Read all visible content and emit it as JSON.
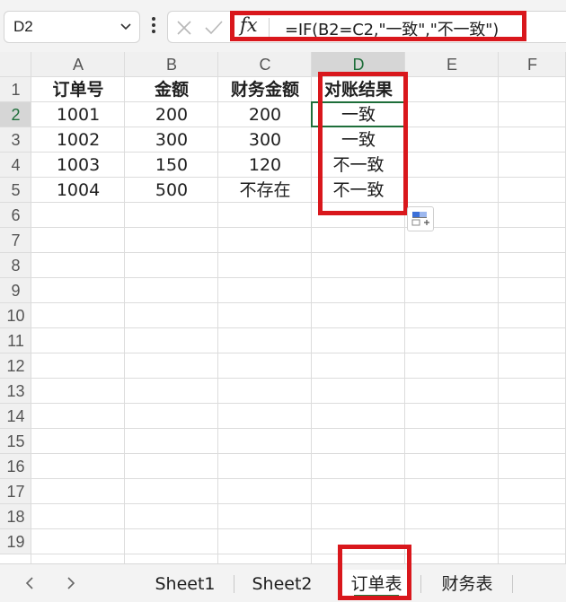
{
  "formula_bar": {
    "name_box": "D2",
    "fx_label": "fx",
    "formula": "=IF(B2=C2,\"一致\",\"不一致\")"
  },
  "columns": [
    "A",
    "B",
    "C",
    "D",
    "E",
    "F"
  ],
  "rows": [
    "1",
    "2",
    "3",
    "4",
    "5",
    "6",
    "7",
    "8",
    "9",
    "10",
    "11",
    "12",
    "13",
    "14",
    "15",
    "16",
    "17",
    "18",
    "19"
  ],
  "cells": {
    "A1": "订单号",
    "B1": "金额",
    "C1": "财务金额",
    "D1": "对账结果",
    "A2": "1001",
    "B2": "200",
    "C2": "200",
    "D2": "一致",
    "A3": "1002",
    "B3": "300",
    "C3": "300",
    "D3": "一致",
    "A4": "1003",
    "B4": "150",
    "C4": "120",
    "D4": "不一致",
    "A5": "1004",
    "B5": "500",
    "C5": "不存在",
    "D5": "不一致"
  },
  "selected_cell": "D2",
  "sheet_tabs": [
    "Sheet1",
    "Sheet2",
    "订单表",
    "财务表"
  ],
  "active_sheet": "订单表",
  "colors": {
    "accent": "#1e6e3a",
    "highlight": "#d9171c"
  }
}
